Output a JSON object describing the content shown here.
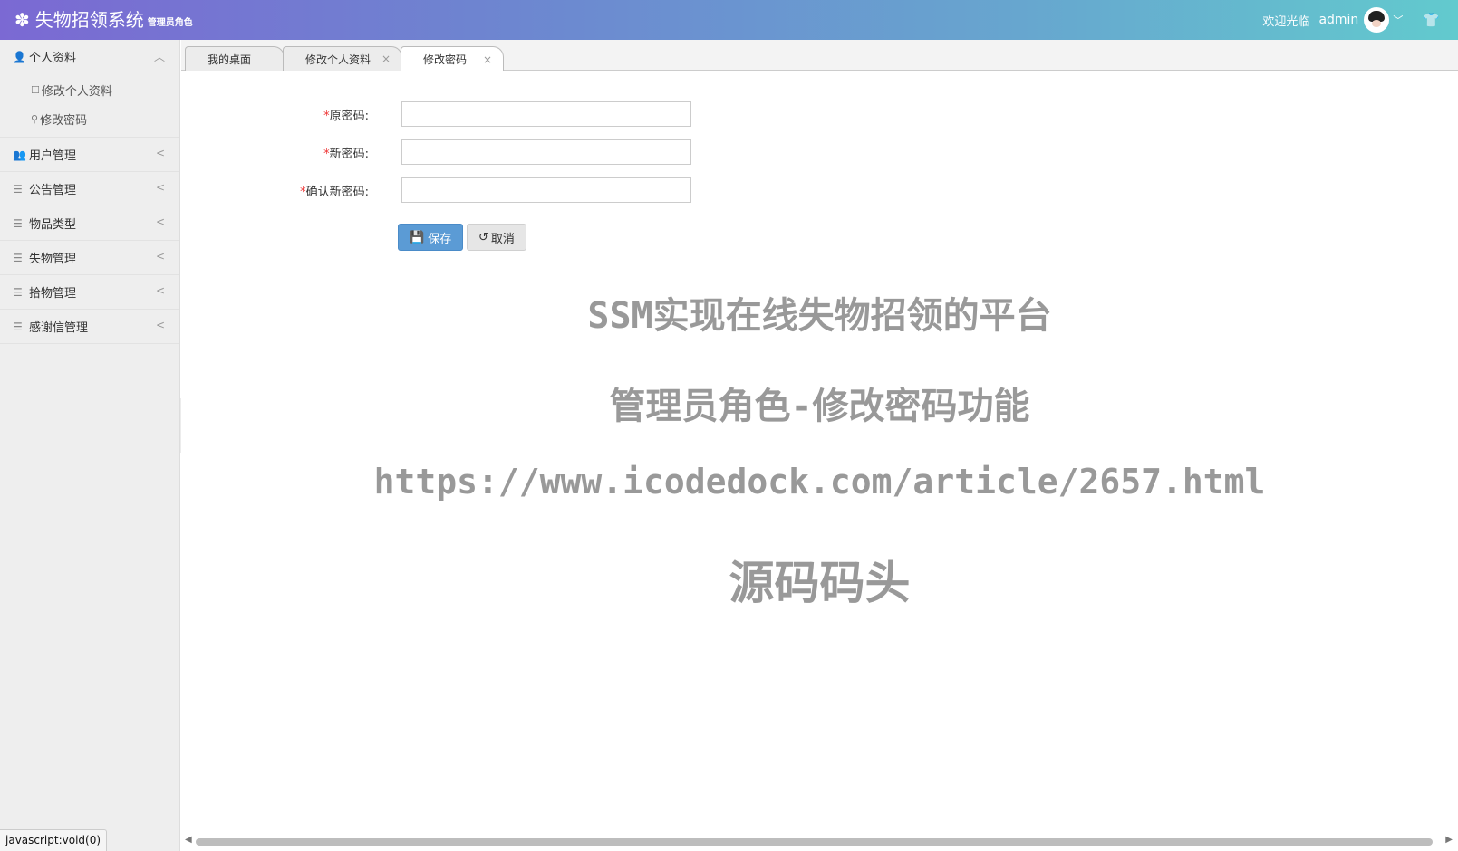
{
  "header": {
    "logo_icon": "gear-icon",
    "title": "失物招领系统",
    "subtitle": "管理员角色",
    "welcome": "欢迎光临",
    "username": "admin",
    "theme_icon": "shirt-icon"
  },
  "sidebar": {
    "groups": [
      {
        "label": "个人资料",
        "icon": "user-icon",
        "expanded": true,
        "items": [
          {
            "label": "修改个人资料",
            "icon": "edit-icon"
          },
          {
            "label": "修改密码",
            "icon": "key-icon"
          }
        ]
      },
      {
        "label": "用户管理",
        "icon": "users-icon",
        "expanded": false
      },
      {
        "label": "公告管理",
        "icon": "list-icon",
        "expanded": false
      },
      {
        "label": "物品类型",
        "icon": "list-icon",
        "expanded": false
      },
      {
        "label": "失物管理",
        "icon": "list-icon",
        "expanded": false
      },
      {
        "label": "拾物管理",
        "icon": "list-icon",
        "expanded": false
      },
      {
        "label": "感谢信管理",
        "icon": "list-icon",
        "expanded": false
      }
    ]
  },
  "tabs": [
    {
      "label": "我的桌面",
      "closable": false,
      "active": false
    },
    {
      "label": "修改个人资料",
      "closable": true,
      "active": false
    },
    {
      "label": "修改密码",
      "closable": true,
      "active": true
    }
  ],
  "form": {
    "old_password_label": "原密码:",
    "new_password_label": "新密码:",
    "confirm_password_label": "确认新密码:",
    "required_mark": "*",
    "old_password_value": "",
    "new_password_value": "",
    "confirm_password_value": "",
    "save_label": "保存",
    "cancel_label": "取消"
  },
  "watermark": {
    "line1": "SSM实现在线失物招领的平台",
    "line2": "管理员角色-修改密码功能",
    "line3": "https://www.icodedock.com/article/2657.html",
    "line4": "源码码头"
  },
  "status_bar": "javascript:void(0)"
}
